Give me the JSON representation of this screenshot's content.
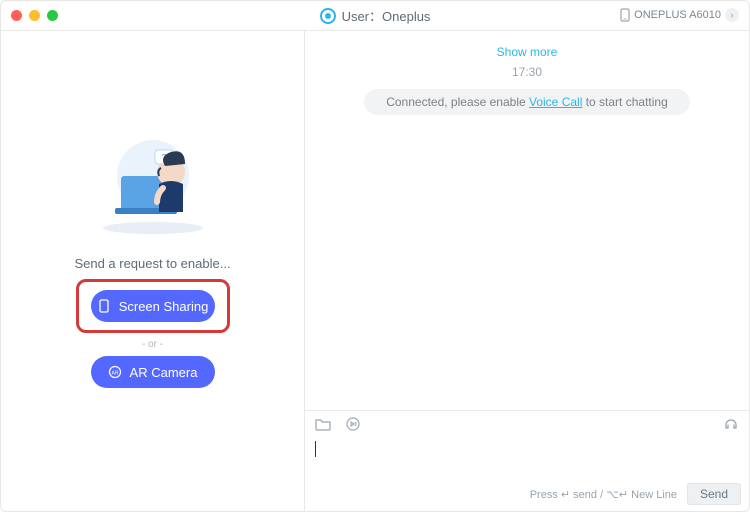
{
  "header": {
    "title_prefix": "User：",
    "title_name": "Oneplus",
    "device_name": "ONEPLUS A6010"
  },
  "sidebar": {
    "prompt": "Send a request to enable...",
    "screen_sharing_label": "Screen Sharing",
    "or_label": "- or -",
    "ar_camera_label": "AR Camera"
  },
  "chat": {
    "show_more": "Show more",
    "timestamp": "17:30",
    "status_prefix": "Connected, please enable ",
    "status_link": "Voice Call",
    "status_suffix": " to start chatting"
  },
  "composer": {
    "hint": "Press ↵ send / ⌥↵ New Line",
    "send_label": "Send"
  }
}
